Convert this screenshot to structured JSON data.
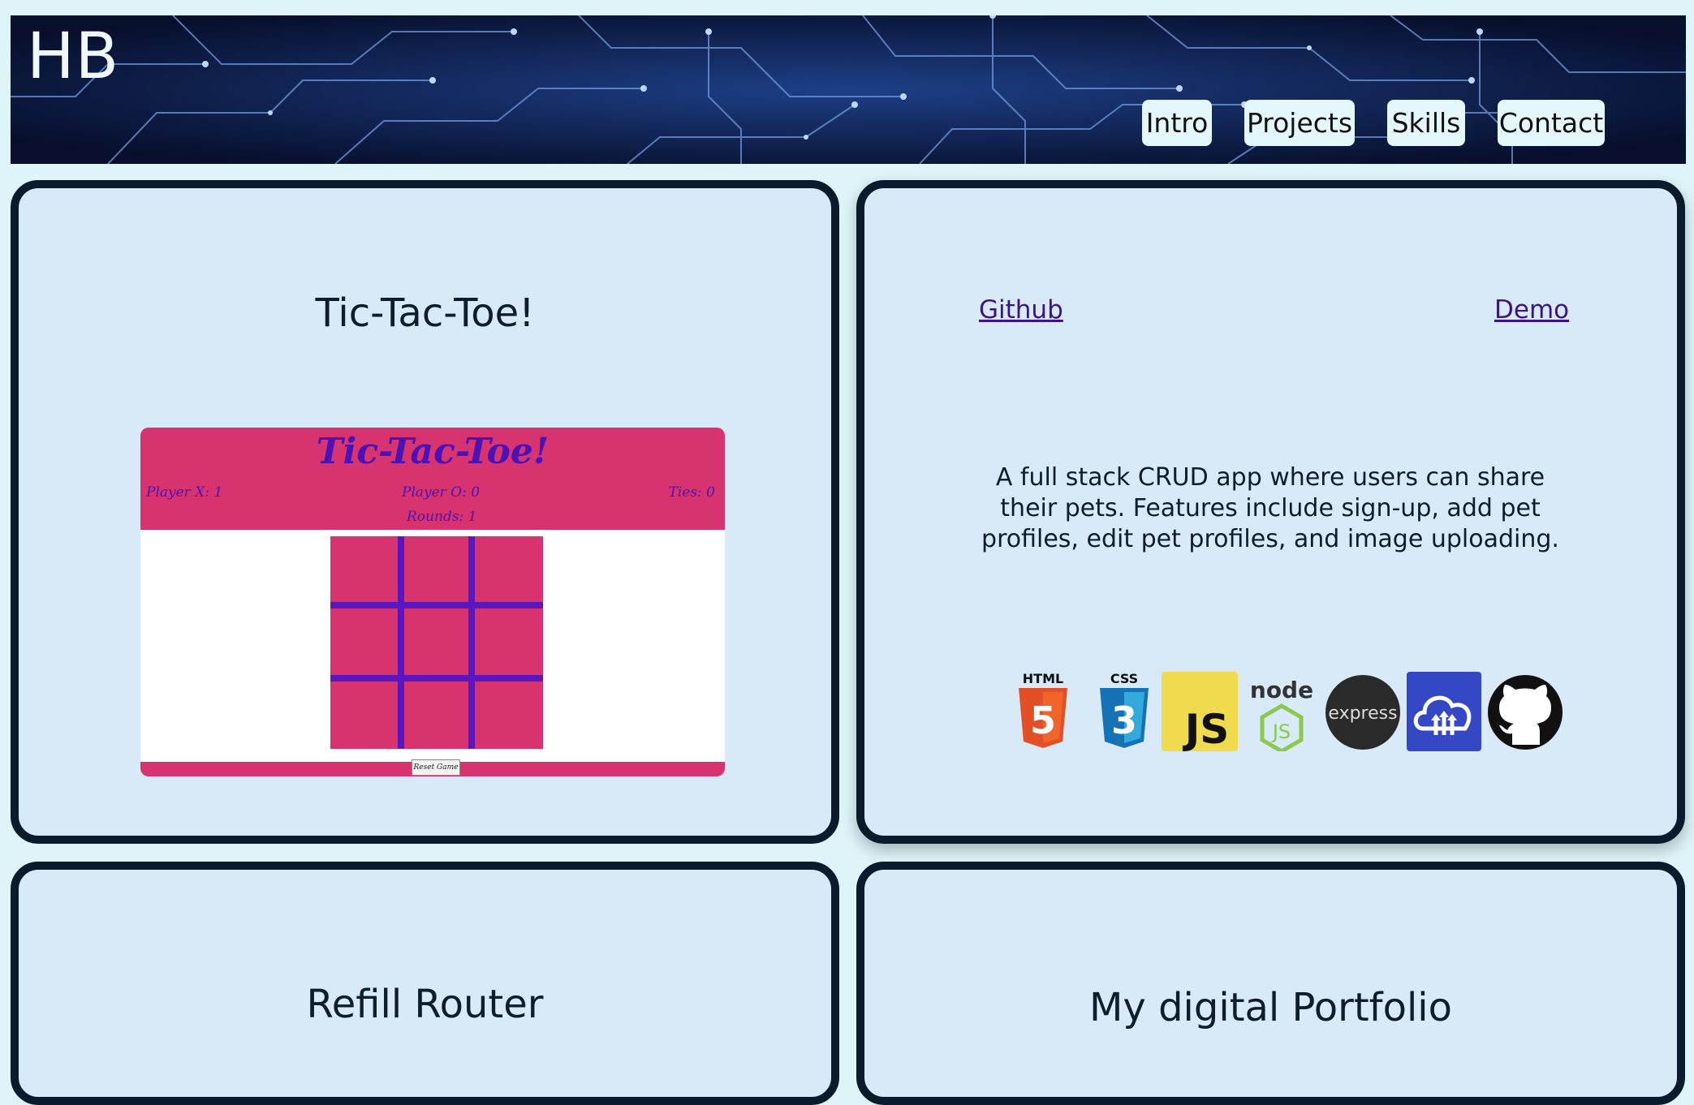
{
  "header": {
    "logo": "HB",
    "nav": [
      {
        "label": "Intro"
      },
      {
        "label": "Projects"
      },
      {
        "label": "Skills"
      },
      {
        "label": "Contact"
      }
    ]
  },
  "projects": [
    {
      "title": "Tic-Tac-Toe!",
      "preview": {
        "title": "Tic-Tac-Toe!",
        "player_x": "Player X: 1",
        "player_o": "Player O: 0",
        "ties": "Ties: 0",
        "rounds": "Rounds: 1",
        "reset_label": "Reset Game"
      }
    },
    {
      "github_label": "Github",
      "demo_label": "Demo",
      "description": "A full stack CRUD app where users can share their pets. Features include sign-up, add pet profiles, edit pet profiles, and image uploading.",
      "tech_icons": [
        {
          "icon": "html5-icon",
          "label": "HTML"
        },
        {
          "icon": "css3-icon",
          "label": "CSS"
        },
        {
          "icon": "javascript-icon",
          "label": "JS"
        },
        {
          "icon": "nodejs-icon",
          "label": "node"
        },
        {
          "icon": "express-icon",
          "label": "express"
        },
        {
          "icon": "cloudinary-icon"
        },
        {
          "icon": "github-icon"
        }
      ]
    },
    {
      "title": "Refill Router"
    },
    {
      "title": "My digital Portfolio"
    }
  ],
  "colors": {
    "page_bg": "#def4f8",
    "card_bg": "#d8e9f7",
    "card_border": "#0c1a2e",
    "game_pink": "#d6336f",
    "game_purple": "#4a12b8",
    "link": "#3b1585"
  }
}
